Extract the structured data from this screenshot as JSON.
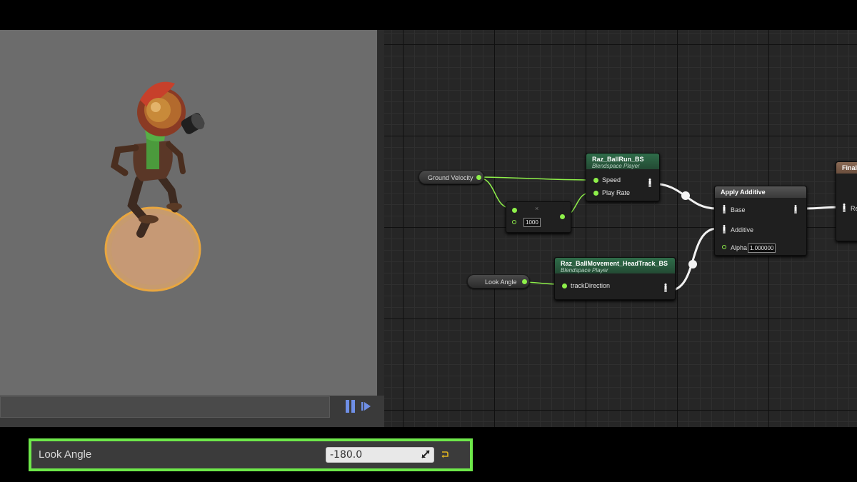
{
  "details_panel": {
    "property_label": "Look Angle",
    "property_value": "-180.0"
  },
  "graph": {
    "ground_velocity": "Ground Velocity",
    "look_angle": "Look Angle",
    "multiply_node": {
      "symbol": "×",
      "value": "1000"
    },
    "ballrun_node": {
      "title": "Raz_BallRun_BS",
      "subtitle": "Blendspace Player",
      "pin_speed": "Speed",
      "pin_playrate": "Play Rate"
    },
    "headtrack_node": {
      "title": "Raz_BallMovement_HeadTrack_BS",
      "subtitle": "Blendspace Player",
      "pin_track": "trackDirection"
    },
    "apply_additive": {
      "title": "Apply Additive",
      "pin_base": "Base",
      "pin_additive": "Additive",
      "pin_alpha": "Alpha",
      "alpha_value": "1.000000"
    },
    "final_node": {
      "title": "Final",
      "pin_result": "Re"
    }
  },
  "colors": {
    "accent_green": "#6ee84a",
    "pin_green": "#8ef04a",
    "play_blue": "#6f8fe6"
  },
  "icons": [
    "pause-icon",
    "play-icon",
    "drag-icon",
    "reset-arrow-icon",
    "pose-pin-icon"
  ]
}
